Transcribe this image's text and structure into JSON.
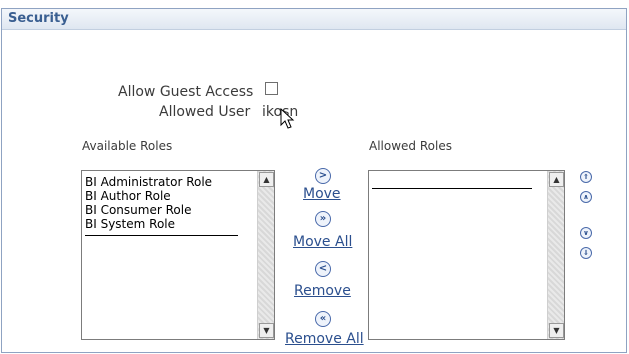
{
  "section": {
    "title": "Security"
  },
  "form": {
    "allow_guest_label": "Allow Guest Access",
    "allowed_user_label": "Allowed User",
    "allowed_user_value": "ikosn",
    "allow_guest_checked": false
  },
  "available": {
    "label": "Available Roles",
    "items": [
      "BI Administrator Role",
      "BI Author Role",
      "BI Consumer Role",
      "BI System Role"
    ]
  },
  "allowed": {
    "label": "Allowed Roles",
    "items": []
  },
  "shuttle": {
    "move": "Move",
    "move_all": "Move All",
    "remove": "Remove",
    "remove_all": "Remove All"
  },
  "icons": {
    "move": "move-right-icon",
    "move_all": "move-all-right-icon",
    "remove": "move-left-icon",
    "remove_all": "move-all-left-icon",
    "top": "move-top-icon",
    "up": "move-up-icon",
    "down": "move-down-icon",
    "bottom": "move-bottom-icon"
  }
}
